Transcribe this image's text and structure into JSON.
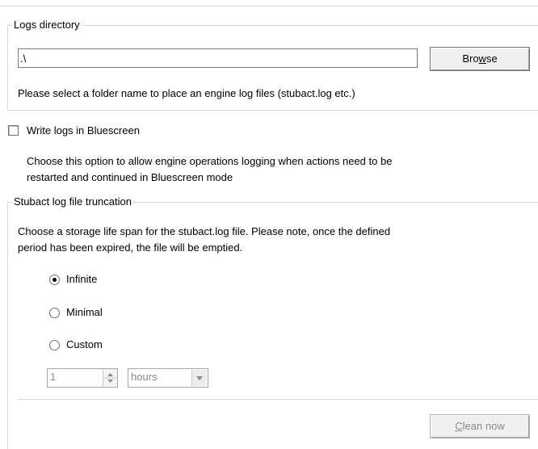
{
  "logs_directory": {
    "legend": "Logs directory",
    "path_value": ".\\",
    "browse_label_pre": "Bro",
    "browse_label_key": "w",
    "browse_label_post": "se",
    "help": "Please select a folder name to place an engine log files (stubact.log etc.)"
  },
  "bluescreen": {
    "checkbox_label": "Write logs in Bluescreen",
    "checked": false,
    "description_line1": "Choose this option to allow engine operations logging when actions need to be",
    "description_line2": "restarted and continued in Bluescreen mode"
  },
  "truncation": {
    "legend": "Stubact log file truncation",
    "description_line1": "Choose a storage life span for the stubact.log file. Please note, once the defined",
    "description_line2": "period has been expired, the file will be emptied.",
    "options": [
      {
        "label": "Infinite",
        "selected": true
      },
      {
        "label": "Minimal",
        "selected": false
      },
      {
        "label": "Custom",
        "selected": false
      }
    ],
    "custom_value": "1",
    "unit_selected": "hours",
    "clean_label_key": "C",
    "clean_label_post": "lean now"
  },
  "icons": {
    "spin_up": "spin-up-icon",
    "spin_down": "spin-down-icon",
    "dropdown": "chevron-down-icon"
  }
}
